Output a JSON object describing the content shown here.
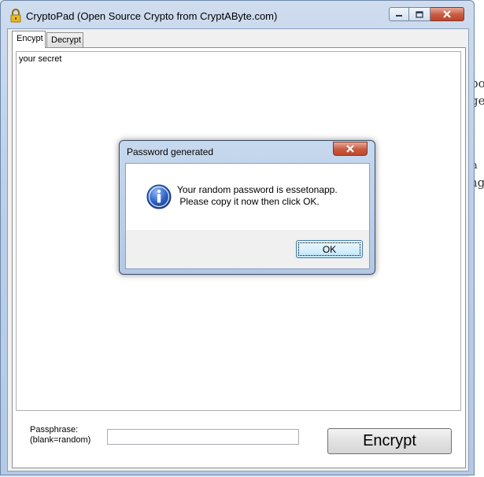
{
  "window": {
    "title": "CryptoPad (Open Source Crypto from CryptAByte.com)"
  },
  "tabs": [
    {
      "label": "Encypt",
      "selected": true
    },
    {
      "label": "Decrypt",
      "selected": false
    }
  ],
  "editor": {
    "text": "your secret"
  },
  "passphrase": {
    "label_line1": "Passphrase:",
    "label_line2": "(blank=random)",
    "value": ""
  },
  "encrypt_button": {
    "label": "Encrypt"
  },
  "dialog": {
    "title": "Password generated",
    "message": "Your random password is essetonapp.\n Please copy it now then click OK.",
    "ok_label": "OK",
    "icon": "info-icon"
  },
  "background_fragments": [
    "po",
    "ge",
    "a",
    "ng"
  ],
  "colors": {
    "close_button": "#c75a40",
    "ok_button_border": "#3c7fb1",
    "info_icon": "#2f63c8"
  }
}
